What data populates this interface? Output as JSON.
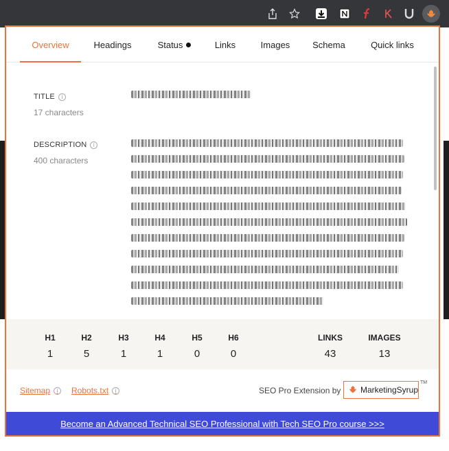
{
  "tabs": [
    {
      "label": "Overview"
    },
    {
      "label": "Headings"
    },
    {
      "label": "Status"
    },
    {
      "label": "Links"
    },
    {
      "label": "Images"
    },
    {
      "label": "Schema"
    },
    {
      "label": "Quick links"
    }
  ],
  "overview": {
    "title_label": "TITLE",
    "title_chars": "17 characters",
    "description_label": "DESCRIPTION",
    "description_chars": "400 characters"
  },
  "stats": {
    "headings": [
      {
        "label": "H1",
        "value": "1"
      },
      {
        "label": "H2",
        "value": "5"
      },
      {
        "label": "H3",
        "value": "1"
      },
      {
        "label": "H4",
        "value": "1"
      },
      {
        "label": "H5",
        "value": "0"
      },
      {
        "label": "H6",
        "value": "0"
      }
    ],
    "links": {
      "label": "LINKS",
      "value": "43"
    },
    "images": {
      "label": "IMAGES",
      "value": "13"
    }
  },
  "footer": {
    "sitemap": "Sitemap",
    "robots": "Robots.txt",
    "credit": "SEO Pro Extension by",
    "brand": "MarketingSyrup",
    "tm": "TM"
  },
  "banner": {
    "text": "Become an Advanced Technical SEO Professional with Tech SEO Pro course >>>"
  },
  "icons": {
    "accent": "#e8743b",
    "banner_bg": "#3f4bd6"
  }
}
